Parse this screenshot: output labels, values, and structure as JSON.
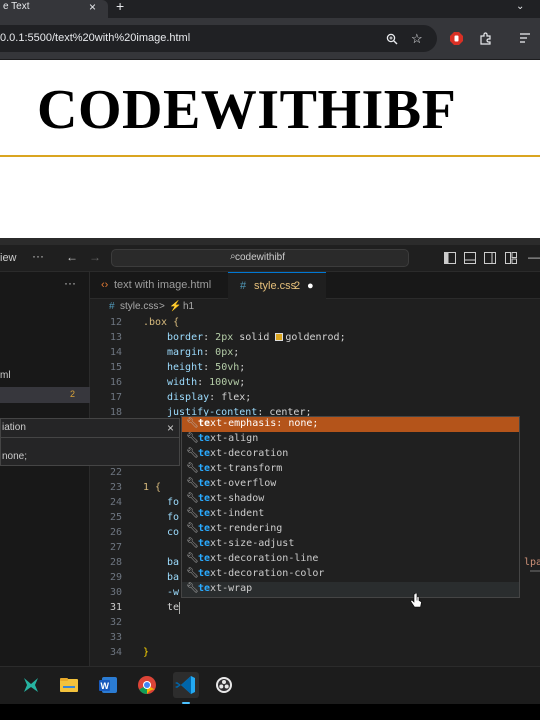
{
  "browser": {
    "tab_title": "e Text",
    "tab_close": "×",
    "new_tab": "+",
    "url": "0.0.1:5500/text%20with%20image.html"
  },
  "page": {
    "box_text": "CODEWITHIBF"
  },
  "vscode": {
    "menu_view": "iew",
    "search_text": "codewithibf",
    "sidebar_file": "ml",
    "sidebar_badge": "2",
    "tabs": [
      {
        "label": "text with image.html"
      },
      {
        "label": "style.css",
        "badge": "2",
        "dirty": "●"
      }
    ],
    "breadcrumb": {
      "file": "style.css",
      "separator": ">",
      "symbol": "h1"
    },
    "code_lines": [
      {
        "n": "12",
        "text": ".box {"
      },
      {
        "n": "13",
        "text": "border: 2px solid goldenrod;"
      },
      {
        "n": "14",
        "text": "margin: 0px;"
      },
      {
        "n": "15",
        "text": "height: 50vh;"
      },
      {
        "n": "16",
        "text": "width: 100vw;"
      },
      {
        "n": "17",
        "text": "display: flex;"
      },
      {
        "n": "18",
        "text": "justify-content: center;"
      },
      {
        "n": "22",
        "text": ""
      },
      {
        "n": "23",
        "text": "1 {"
      },
      {
        "n": "24",
        "text": "fo"
      },
      {
        "n": "25",
        "text": "fo"
      },
      {
        "n": "26",
        "text": "co"
      },
      {
        "n": "27",
        "text": ""
      },
      {
        "n": "28",
        "text": "ba"
      },
      {
        "n": "29",
        "text": "ba"
      },
      {
        "n": "30",
        "text": "-w"
      },
      {
        "n": "31",
        "text": "te"
      },
      {
        "n": "32",
        "text": ""
      },
      {
        "n": "33",
        "text": ""
      },
      {
        "n": "34",
        "text": "}"
      }
    ],
    "overflow_text": "lpa",
    "peek": {
      "title": "iation",
      "value": "none;",
      "close": "×"
    },
    "suggestions": [
      {
        "match": "te",
        "rest": "xt-emphasis: none;"
      },
      {
        "match": "te",
        "rest": "xt-align"
      },
      {
        "match": "te",
        "rest": "xt-decoration"
      },
      {
        "match": "te",
        "rest": "xt-transform"
      },
      {
        "match": "te",
        "rest": "xt-overflow"
      },
      {
        "match": "te",
        "rest": "xt-shadow"
      },
      {
        "match": "te",
        "rest": "xt-indent"
      },
      {
        "match": "te",
        "rest": "xt-rendering"
      },
      {
        "match": "te",
        "rest": "xt-size-adjust"
      },
      {
        "match": "te",
        "rest": "xt-decoration-line"
      },
      {
        "match": "te",
        "rest": "xt-decoration-color"
      },
      {
        "match": "te",
        "rest": "xt-wrap"
      }
    ]
  },
  "colors": {
    "accent_border": "#daa520",
    "suggest_selected": "#b4541a",
    "match_highlight": "#2aaaff"
  },
  "taskbar": {
    "apps": [
      "xbox-icon",
      "file-explorer-icon",
      "word-icon",
      "chrome-icon",
      "vscode-icon",
      "obs-icon"
    ]
  }
}
